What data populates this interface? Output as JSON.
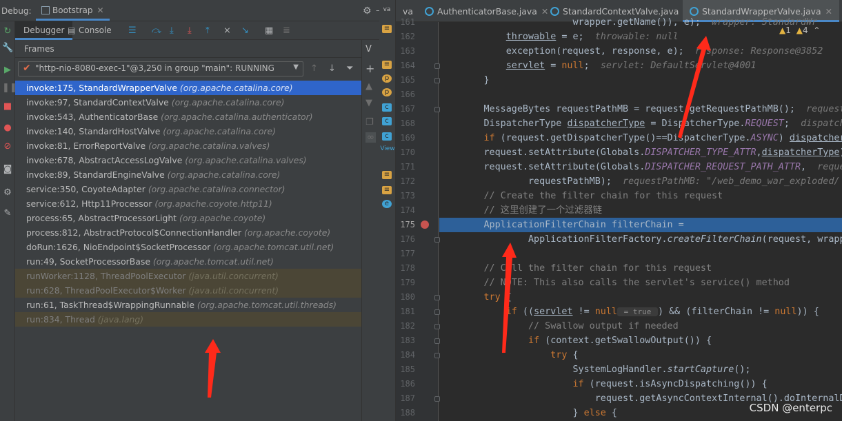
{
  "debug_bar": {
    "label": "Debug:",
    "session_tab": "Bootstrap"
  },
  "subtabs": {
    "debugger": "Debugger",
    "console": "Console"
  },
  "frames_header": "Frames",
  "vars_label": "V",
  "thread": {
    "label": "\"http-nio-8080-exec-1\"@3,250 in group \"main\": RUNNING"
  },
  "frames": [
    {
      "method": "invoke:175, StandardWrapperValve",
      "package": "(org.apache.catalina.core)",
      "state": "selected"
    },
    {
      "method": "invoke:97, StandardContextValve",
      "package": "(org.apache.catalina.core)",
      "state": "normal"
    },
    {
      "method": "invoke:543, AuthenticatorBase",
      "package": "(org.apache.catalina.authenticator)",
      "state": "normal"
    },
    {
      "method": "invoke:140, StandardHostValve",
      "package": "(org.apache.catalina.core)",
      "state": "normal"
    },
    {
      "method": "invoke:81, ErrorReportValve",
      "package": "(org.apache.catalina.valves)",
      "state": "normal"
    },
    {
      "method": "invoke:678, AbstractAccessLogValve",
      "package": "(org.apache.catalina.valves)",
      "state": "normal"
    },
    {
      "method": "invoke:89, StandardEngineValve",
      "package": "(org.apache.catalina.core)",
      "state": "normal"
    },
    {
      "method": "service:350, CoyoteAdapter",
      "package": "(org.apache.catalina.connector)",
      "state": "normal"
    },
    {
      "method": "service:612, Http11Processor",
      "package": "(org.apache.coyote.http11)",
      "state": "normal"
    },
    {
      "method": "process:65, AbstractProcessorLight",
      "package": "(org.apache.coyote)",
      "state": "normal"
    },
    {
      "method": "process:812, AbstractProtocol$ConnectionHandler",
      "package": "(org.apache.coyote)",
      "state": "normal"
    },
    {
      "method": "doRun:1626, NioEndpoint$SocketProcessor",
      "package": "(org.apache.tomcat.util.net)",
      "state": "normal"
    },
    {
      "method": "run:49, SocketProcessorBase",
      "package": "(org.apache.tomcat.util.net)",
      "state": "normal"
    },
    {
      "method": "runWorker:1128, ThreadPoolExecutor",
      "package": "(java.util.concurrent)",
      "state": "library"
    },
    {
      "method": "run:628, ThreadPoolExecutor$Worker",
      "package": "(java.util.concurrent)",
      "state": "library"
    },
    {
      "method": "run:61, TaskThread$WrappingRunnable",
      "package": "(org.apache.tomcat.util.threads)",
      "state": "normal"
    },
    {
      "method": "run:834, Thread",
      "package": "(java.lang)",
      "state": "library"
    }
  ],
  "editor_tabs": [
    {
      "label": "va",
      "active": false,
      "partial": true
    },
    {
      "label": "AuthenticatorBase.java",
      "active": false
    },
    {
      "label": "StandardContextValve.java",
      "active": false
    },
    {
      "label": "StandardWrapperValve.java",
      "active": true
    }
  ],
  "inspection": {
    "warnings": "1",
    "weak_warnings": "4"
  },
  "code_lines": [
    {
      "n": "161",
      "html": "                    wrapper.getName()), e);  <span class=\"inl\">wrapper: StandardWr</span>"
    },
    {
      "n": "162",
      "html": "        <span class=\"ul\">throwable</span> = e;  <span class=\"inl\">throwable: null</span>"
    },
    {
      "n": "163",
      "html": "        exception(request, response, e);  <span class=\"inl\">response: Response@3852</span>"
    },
    {
      "n": "164",
      "html": "        <span class=\"ul\">servlet</span> = <span class=\"kw\">null</span>;  <span class=\"inl\">servlet: DefaultServlet@4001</span>"
    },
    {
      "n": "165",
      "html": "    }"
    },
    {
      "n": "166",
      "html": ""
    },
    {
      "n": "167",
      "html": "    MessageBytes requestPathMB = request.getRequestPathMB();  <span class=\"inl\">requestPathMB</span>"
    },
    {
      "n": "168",
      "html": "    DispatcherType <span class=\"ul\">dispatcherType</span> = DispatcherType.<span class=\"st\">REQUEST</span>;  <span class=\"inl\">dispatcherType</span>"
    },
    {
      "n": "169",
      "html": "    <span class=\"kw\">if</span> (request.getDispatcherType()==DispatcherType.<span class=\"st\">ASYNC</span>) <span class=\"ul\">dispatcherType</span>"
    },
    {
      "n": "170",
      "html": "    request.setAttribute(Globals.<span class=\"st\">DISPATCHER_TYPE_ATTR</span>,<span class=\"ul\">dispatcherType</span>);"
    },
    {
      "n": "171",
      "html": "    request.setAttribute(Globals.<span class=\"st\">DISPATCHER_REQUEST_PATH_ATTR</span>,  <span class=\"inl\">request</span>"
    },
    {
      "n": "172",
      "html": "            requestPathMB);  <span class=\"inl\">requestPathMB: \"/web_demo_war_exploded/</span>"
    },
    {
      "n": "173",
      "html": "    <span class=\"cm\">// Create the filter chain for this request</span>"
    },
    {
      "n": "174",
      "html": "    <span class=\"cm\">// 这里创建了一个过滤器链</span>"
    },
    {
      "n": "175",
      "html": "    ApplicationFilterChain filterChain =",
      "hl": true
    },
    {
      "n": "176",
      "html": "            ApplicationFilterFactory.<span class=\"mt\">createFilterChain</span>(request, wrapper"
    },
    {
      "n": "177",
      "html": ""
    },
    {
      "n": "178",
      "html": "    <span class=\"cm\">// Call the filter chain for this request</span>"
    },
    {
      "n": "179",
      "html": "    <span class=\"cm\">// NOTE: This also calls the servlet's service() method</span>"
    },
    {
      "n": "180",
      "html": "    <span class=\"kw\">try</span> {"
    },
    {
      "n": "181",
      "html": "        <span class=\"kw\">if</span> ((<span class=\"ul\">servlet</span> != <span class=\"kw\">null</span><span class=\"hint\"> = true </span>) &amp;&amp; (filterChain != <span class=\"kw\">null</span>)) {"
    },
    {
      "n": "182",
      "html": "            <span class=\"cm\">// Swallow output if needed</span>"
    },
    {
      "n": "183",
      "html": "            <span class=\"kw\">if</span> (context.getSwallowOutput()) {"
    },
    {
      "n": "184",
      "html": "                <span class=\"kw\">try</span> {"
    },
    {
      "n": "185",
      "html": "                    SystemLogHandler.<span class=\"mt\">startCapture</span>();"
    },
    {
      "n": "186",
      "html": "                    <span class=\"kw\">if</span> (request.isAsyncDispatching()) {"
    },
    {
      "n": "187",
      "html": "                        request.getAsyncContextInternal().doInternalD"
    },
    {
      "n": "188",
      "html": "                    } <span class=\"kw\">else</span> {"
    }
  ],
  "watermark": "CSDN @enterpc",
  "colors": {
    "accent": "#4a88c7",
    "selection": "#2f65ca",
    "line_highlight": "#2d6099",
    "arrow": "#ff2a1a"
  }
}
